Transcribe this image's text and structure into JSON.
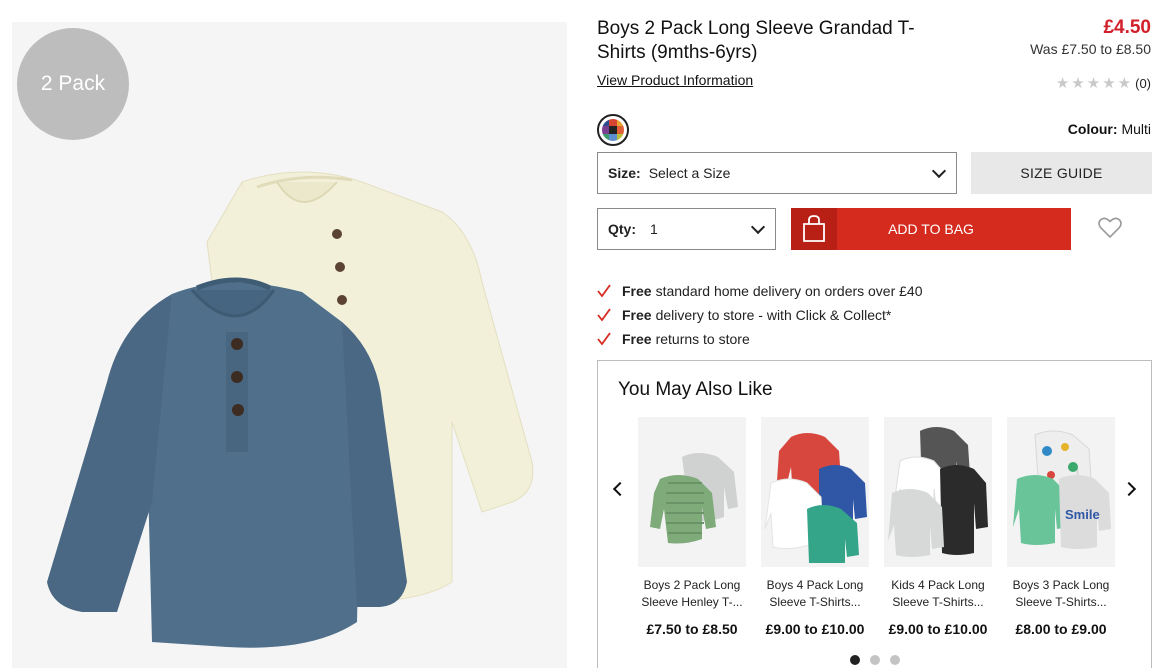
{
  "product": {
    "badge": "2 Pack",
    "title": "Boys 2 Pack Long Sleeve Grandad T-Shirts (9mths-6yrs)",
    "price": "£4.50",
    "was_price": "Was £7.50 to £8.50",
    "view_info_link": "View Product Information",
    "rating": {
      "stars": 0,
      "count_label": "(0)"
    },
    "colour": {
      "label": "Colour:",
      "value": "Multi"
    }
  },
  "size": {
    "label": "Size:",
    "value": "Select a Size",
    "guide_label": "SIZE GUIDE"
  },
  "quantity": {
    "label": "Qty:",
    "value": "1"
  },
  "add_to_bag_label": "ADD TO BAG",
  "benefits": [
    {
      "bold": "Free",
      "text": "standard home delivery on orders over £40"
    },
    {
      "bold": "Free",
      "text": "delivery to store - with Click & Collect*"
    },
    {
      "bold": "Free",
      "text": "returns to store"
    }
  ],
  "recommendations": {
    "title": "You May Also Like",
    "items": [
      {
        "name": "Boys 2 Pack Long Sleeve Henley T-...",
        "price": "£7.50 to £8.50"
      },
      {
        "name": "Boys 4 Pack Long Sleeve T-Shirts...",
        "price": "£9.00 to £10.00"
      },
      {
        "name": "Kids 4 Pack Long Sleeve T-Shirts...",
        "price": "£9.00 to £10.00"
      },
      {
        "name": "Boys 3 Pack Long Sleeve T-Shirts...",
        "price": "£8.00 to £9.00"
      }
    ],
    "pages": 3,
    "active_page": 1
  },
  "colors": {
    "accent_red": "#d52b1e",
    "price_red": "#d2202b",
    "tick_red": "#d52b1e"
  },
  "icons": [
    "bag-icon",
    "heart-icon",
    "check-icon",
    "star-icon",
    "chevron-down-icon",
    "chevron-left-icon",
    "chevron-right-icon"
  ]
}
